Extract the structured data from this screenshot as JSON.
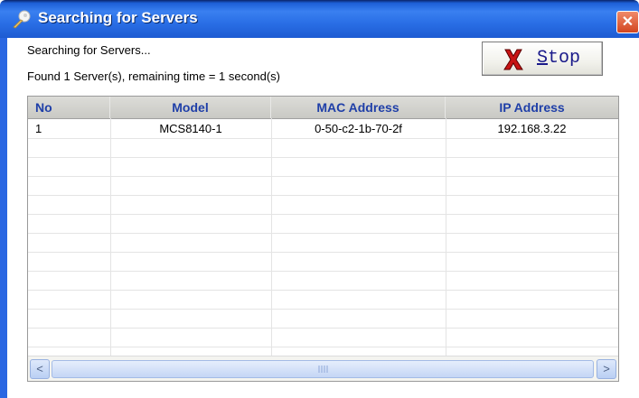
{
  "window": {
    "title": "Searching for Servers",
    "close_icon": "close-icon",
    "title_icon": "search-key-icon",
    "colors": {
      "titlebar": "#2a6fe6",
      "close": "#d2451f",
      "header_text": "#1f3fa8"
    }
  },
  "status": {
    "line1": "Searching for Servers...",
    "line2": "Found 1 Server(s), remaining time = 1 second(s)"
  },
  "stop_button": {
    "label_first": "S",
    "label_rest": "top",
    "icon": "red-x-icon"
  },
  "table": {
    "columns": [
      "No",
      "Model",
      "MAC Address",
      "IP Address"
    ],
    "rows": [
      [
        "1",
        "MCS8140-1",
        "0-50-c2-1b-70-2f",
        "192.168.3.22"
      ]
    ]
  },
  "scrollbar": {
    "left_arrow": "<",
    "right_arrow": ">"
  }
}
